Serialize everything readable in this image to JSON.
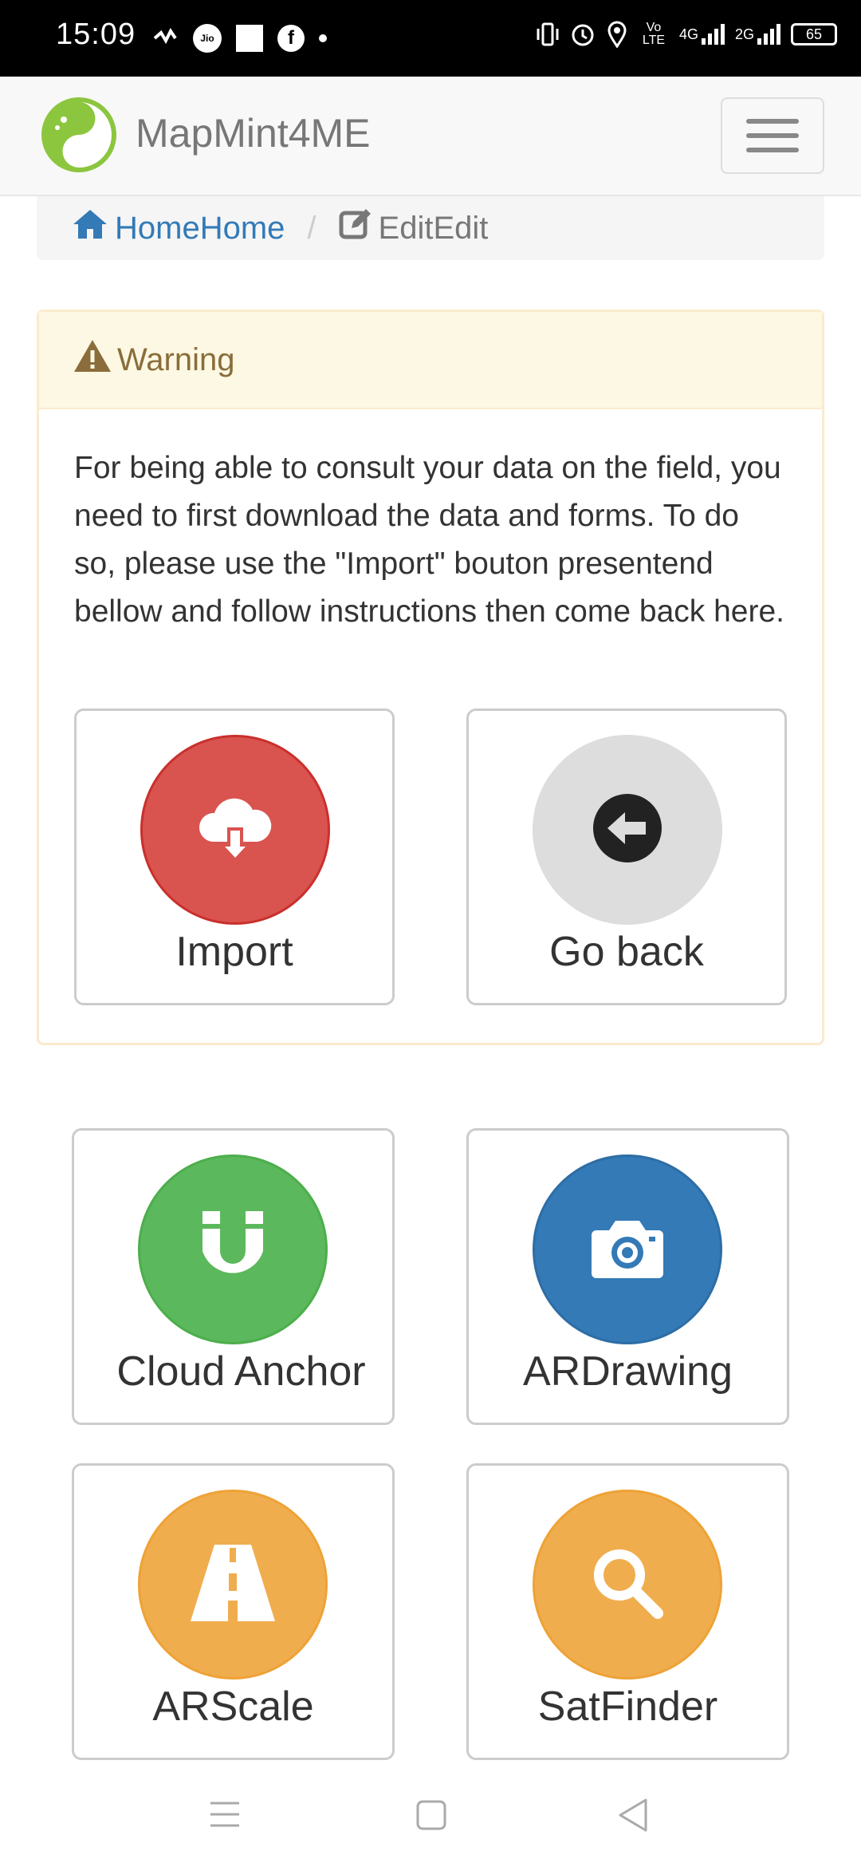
{
  "status_bar": {
    "time": "15:09",
    "battery": "65",
    "left_icons": [
      "activity-icon",
      "jio-icon",
      "square-icon",
      "facebook-icon",
      "dot-icon"
    ],
    "right_icons": [
      "vibrate-icon",
      "alarm-icon",
      "location-icon",
      "volte-icon",
      "signal-4g-icon",
      "signal-2g-icon",
      "battery-icon"
    ],
    "network_4g": "4G",
    "network_2g": "2G",
    "volte": "Vo LTE"
  },
  "navbar": {
    "brand": "MapMint4ME"
  },
  "breadcrumb": {
    "home": "HomeHome",
    "separator": "/",
    "edit": "EditEdit"
  },
  "warning": {
    "title": "Warning",
    "message": "For being able to consult your data on the field, you need to first download the data and forms. To do so, please use the \"Import\" bouton presentend bellow and follow instructions then come back here.",
    "buttons": {
      "import": "Import",
      "go_back": "Go back"
    }
  },
  "tools": {
    "cloud_anchor": "Cloud Anchor",
    "ardrawing": "ARDrawing",
    "arscale": "ARScale",
    "satfinder": "SatFinder"
  },
  "colors": {
    "import": "#d9534f",
    "go_back": "#dddddd",
    "cloud_anchor": "#5cb85c",
    "ardrawing": "#337ab7",
    "arscale": "#f0ad4e",
    "satfinder": "#f0ad4e",
    "link": "#337ab7",
    "warning_text": "#8a6d3b"
  }
}
